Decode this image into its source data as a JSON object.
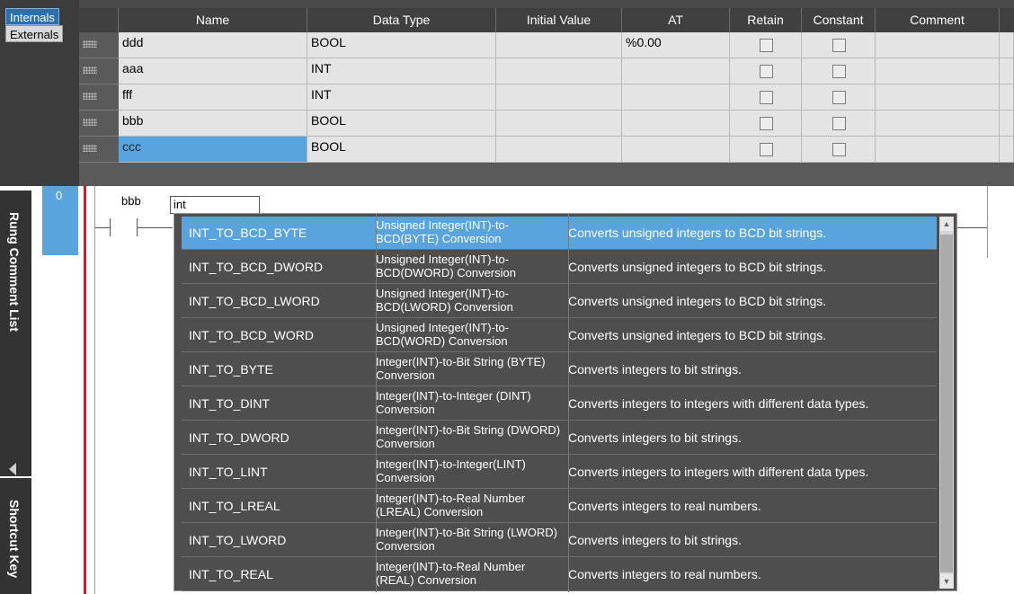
{
  "side_tabs": {
    "internals": "Internals",
    "externals": "Externals"
  },
  "table": {
    "headers": [
      "Name",
      "Data Type",
      "Initial Value",
      "AT",
      "Retain",
      "Constant",
      "Comment"
    ],
    "rows": [
      {
        "name": "ddd",
        "type": "BOOL",
        "initial": "",
        "at": "%0.00",
        "retain": false,
        "constant": false,
        "comment": ""
      },
      {
        "name": "aaa",
        "type": "INT",
        "initial": "",
        "at": "",
        "retain": false,
        "constant": false,
        "comment": ""
      },
      {
        "name": "fff",
        "type": "INT",
        "initial": "",
        "at": "",
        "retain": false,
        "constant": false,
        "comment": ""
      },
      {
        "name": "bbb",
        "type": "BOOL",
        "initial": "",
        "at": "",
        "retain": false,
        "constant": false,
        "comment": ""
      },
      {
        "name": "ccc",
        "type": "BOOL",
        "initial": "",
        "at": "",
        "retain": false,
        "constant": false,
        "comment": ""
      }
    ],
    "selected_row": 4
  },
  "panels": {
    "rung_comment": "Rung Comment List",
    "shortcut": "Shortcut Key"
  },
  "ladder": {
    "rung_number": "0",
    "contact": "bbb",
    "input_text": "int"
  },
  "autocomplete": [
    {
      "name": "INT_TO_BCD_BYTE",
      "desc": "Unsigned Integer(INT)-to-BCD(BYTE) Conversion",
      "detail": "Converts unsigned integers to BCD bit strings."
    },
    {
      "name": "INT_TO_BCD_DWORD",
      "desc": "Unsigned Integer(INT)-to-BCD(DWORD) Conversion",
      "detail": "Converts unsigned integers to BCD bit strings."
    },
    {
      "name": "INT_TO_BCD_LWORD",
      "desc": "Unsigned Integer(INT)-to-BCD(LWORD) Conversion",
      "detail": "Converts unsigned integers to BCD bit strings."
    },
    {
      "name": "INT_TO_BCD_WORD",
      "desc": "Unsigned Integer(INT)-to-BCD(WORD) Conversion",
      "detail": "Converts unsigned integers to BCD bit strings."
    },
    {
      "name": "INT_TO_BYTE",
      "desc": "Integer(INT)-to-Bit String (BYTE) Conversion",
      "detail": "Converts integers to bit strings."
    },
    {
      "name": "INT_TO_DINT",
      "desc": "Integer(INT)-to-Integer (DINT) Conversion",
      "detail": "Converts integers to integers with different data types."
    },
    {
      "name": "INT_TO_DWORD",
      "desc": "Integer(INT)-to-Bit String (DWORD) Conversion",
      "detail": "Converts integers to bit strings."
    },
    {
      "name": "INT_TO_LINT",
      "desc": "Integer(INT)-to-Integer(LINT) Conversion",
      "detail": "Converts integers to integers with different data types."
    },
    {
      "name": "INT_TO_LREAL",
      "desc": "Integer(INT)-to-Real Number (LREAL) Conversion",
      "detail": "Converts integers to real numbers."
    },
    {
      "name": "INT_TO_LWORD",
      "desc": "Integer(INT)-to-Bit String (LWORD) Conversion",
      "detail": "Converts integers to bit strings."
    },
    {
      "name": "INT_TO_REAL",
      "desc": "Integer(INT)-to-Real Number (REAL) Conversion",
      "detail": "Converts integers to real numbers."
    }
  ],
  "autocomplete_selected": 0,
  "colors": {
    "accent": "#5aa4de",
    "rail": "#c8202a",
    "panel": "#333333",
    "list_bg": "#4e4e4e"
  },
  "icons": {
    "scroll_up": "chevron-up-icon",
    "scroll_down": "chevron-down-icon",
    "collapse": "triangle-left-icon"
  }
}
